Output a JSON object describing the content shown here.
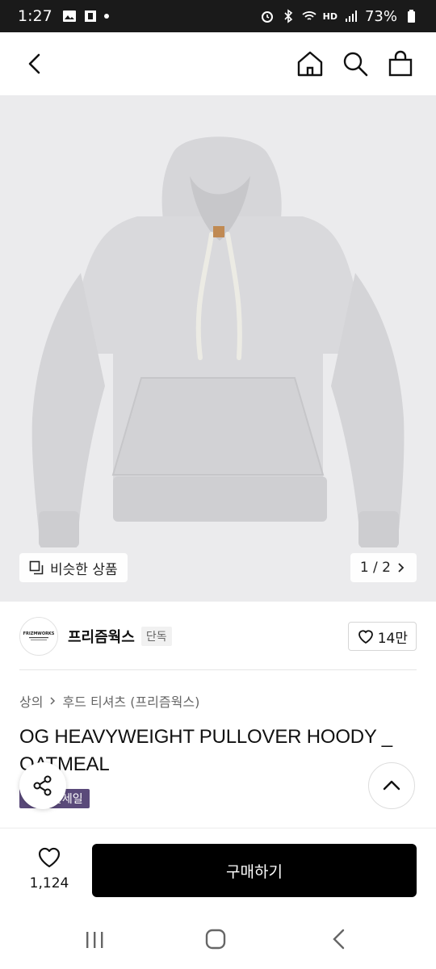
{
  "status": {
    "time": "1:27",
    "battery": "73%",
    "network": "HD"
  },
  "nav": {
    "back_icon": "chevron-left-icon",
    "home_icon": "home-icon",
    "search_icon": "search-icon",
    "cart_icon": "shopping-bag-icon"
  },
  "hero": {
    "similar_label": "비슷한 상품",
    "pager": "1 / 2"
  },
  "brand": {
    "name": "프리즘웍스",
    "tag": "단독",
    "logo_text": "FRIZMWORKS",
    "likes": "14만"
  },
  "product": {
    "breadcrumb": [
      "상의",
      "후드 티셔츠 (프리즘웍스)"
    ],
    "title": "OG HEAVYWEIGHT PULLOVER HOODY _ OATMEAL",
    "badge": "간세일"
  },
  "bottom": {
    "wish_count": "1,124",
    "buy_label": "구매하기"
  },
  "colors": {
    "buy": "#000000",
    "badge": "#5a4a7a",
    "hero_bg": "#ebebed",
    "hoodie": "#d9d9dc"
  }
}
